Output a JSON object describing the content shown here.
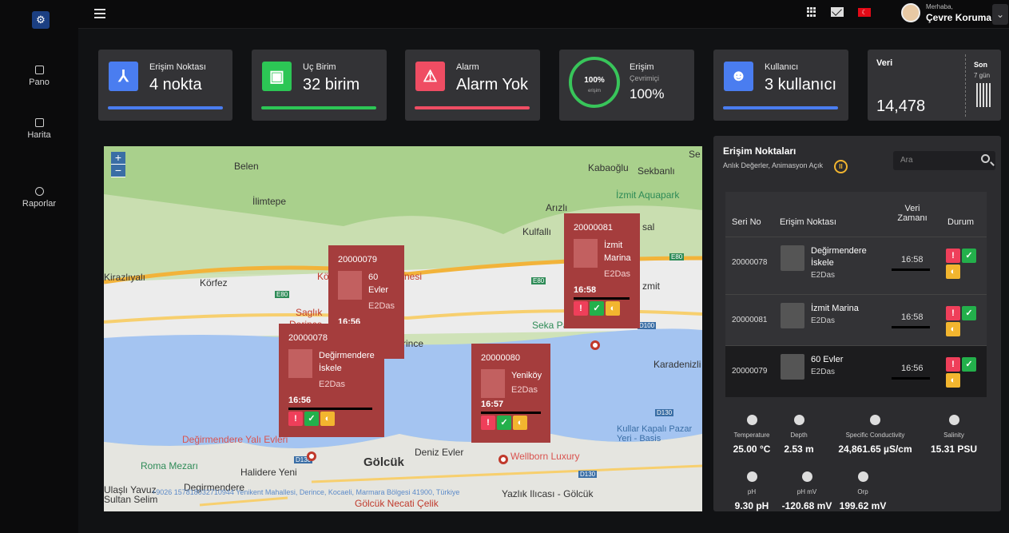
{
  "sidebar": {
    "items": [
      {
        "label": "Pano",
        "icon": "dashboard-icon"
      },
      {
        "label": "Harita",
        "icon": "map-icon"
      },
      {
        "label": "Raporlar",
        "icon": "history-icon"
      }
    ]
  },
  "topbar": {
    "greeting": "Merhaba,",
    "username": "Çevre Koruma"
  },
  "cards": [
    {
      "title": "Erişim Noktası",
      "value": "4 nokta",
      "color": "#4a7df0"
    },
    {
      "title": "Uç Birim",
      "value": "32 birim",
      "color": "#2cc655"
    },
    {
      "title": "Alarm",
      "value": "Alarm Yok",
      "color": "#ef4d63"
    },
    {
      "title": "Erişim",
      "subtitle": "Çevrimiçi",
      "value": "100%",
      "ring_pct": "100%",
      "ring_sub": "erişim",
      "color": "#38c55a"
    },
    {
      "title": "Kullanıcı",
      "value": "3 kullanıcı",
      "color": "#4a7df0"
    }
  ],
  "veri": {
    "title": "Veri",
    "value": "14,478",
    "son": "Son",
    "range": "7 gün"
  },
  "map": {
    "labels": [
      "Belen",
      "İlimtepe",
      "Kabaoğlu",
      "Sekbanlı",
      "İzmit Aquapark",
      "Arızlı",
      "Kulfallı",
      "Kirazlıyalı",
      "Körfez",
      "Saglık",
      "Derince",
      "Seka Park",
      "Karadenizli",
      "Deniz Evler",
      "Wellborn Luxury",
      "Gölcük",
      "Halidere Yeni",
      "Roma Mezarı",
      "Değirmendere Yalı Evleri",
      "Kullar Kapalı Pazar Yeri - Basis",
      "Degirmendere",
      "Ulaşlı Yavuz Sultan Selim",
      "Gölcük Necati Çelik",
      "Yazlık Ilıcası - Gölcük",
      "Se",
      "sal",
      "zmit",
      "Kö",
      "nesi",
      "rince"
    ],
    "road_labels": [
      "E80",
      "E80",
      "E80",
      "D100",
      "D130",
      "D130",
      "D130"
    ],
    "popups": [
      {
        "serial": "20000079",
        "name_lines": [
          "60",
          "Evler"
        ],
        "company": "E2Das",
        "time": "16:56"
      },
      {
        "serial": "20000081",
        "name_lines": [
          "İzmit",
          "Marina"
        ],
        "company": "E2Das",
        "time": "16:58"
      },
      {
        "serial": "20000078",
        "name_lines": [
          "Değirmendere",
          "İskele"
        ],
        "company": "E2Das",
        "time": "16:56"
      },
      {
        "serial": "20000080",
        "name_lines": [
          "Yeniköy"
        ],
        "company": "E2Das",
        "time": "16:57"
      }
    ],
    "footer_text": "+9026 157818032710944   Yenikent Mahallesi, Derince, Kocaeli, Marmara Bölgesi 41900, Türkiye"
  },
  "panel": {
    "title": "Erişim Noktaları",
    "subtitle": "Anlık Değerler, Animasyon Açık",
    "search_placeholder": "Ara",
    "headers": {
      "serial": "Seri No",
      "point": "Erişim Noktası",
      "time_line1": "Veri",
      "time_line2": "Zamanı",
      "status": "Durum"
    },
    "rows": [
      {
        "serial": "20000078",
        "name_lines": [
          "Değirmendere",
          "İskele"
        ],
        "company": "E2Das",
        "time": "16:58"
      },
      {
        "serial": "20000081",
        "name_lines": [
          "İzmit Marina"
        ],
        "company": "E2Das",
        "time": "16:58"
      },
      {
        "serial": "20000079",
        "name_lines": [
          "60 Evler"
        ],
        "company": "E2Das",
        "time": "16:56"
      }
    ],
    "sensors": [
      {
        "label": "Temperature",
        "value": "25.00 °C"
      },
      {
        "label": "Depth",
        "value": "2.53 m"
      },
      {
        "label": "Specific Conductivity",
        "value": "24,861.65 µS/cm"
      },
      {
        "label": "Salinity",
        "value": "15.31 PSU"
      },
      {
        "label": "pH",
        "value": "9.30 pH"
      },
      {
        "label": "pH mV",
        "value": "-120.68 mV"
      },
      {
        "label": "Orp",
        "value": "199.62 mV"
      }
    ]
  }
}
